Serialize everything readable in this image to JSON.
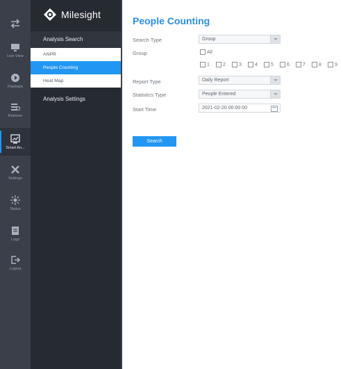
{
  "rail": {
    "items": [
      {
        "icon": "exchange-icon",
        "label": ""
      },
      {
        "icon": "live-view-icon",
        "label": "Live View"
      },
      {
        "icon": "playback-icon",
        "label": "Playback"
      },
      {
        "icon": "retrieve-icon",
        "label": "Retrieve"
      },
      {
        "icon": "smart-analysis-icon",
        "label": "Smart An..."
      },
      {
        "icon": "settings-icon",
        "label": "Settings"
      },
      {
        "icon": "status-icon",
        "label": "Status"
      },
      {
        "icon": "logs-icon",
        "label": "Logs"
      },
      {
        "icon": "logout-icon",
        "label": "Logout"
      }
    ]
  },
  "panel": {
    "brand": "Milesight",
    "sections": [
      {
        "label": "Analysis Search"
      },
      {
        "label": "Analysis Settings"
      }
    ],
    "items": [
      {
        "label": "ANPR"
      },
      {
        "label": "People Counting"
      },
      {
        "label": "Heat Map"
      }
    ]
  },
  "main": {
    "title": "People Counting",
    "search_type": {
      "label": "Search Type",
      "value": "Group"
    },
    "group": {
      "label": "Group",
      "all_label": "All",
      "options": [
        "1",
        "2",
        "3",
        "4",
        "5",
        "6",
        "7",
        "8",
        "9"
      ]
    },
    "report_type": {
      "label": "Report Type",
      "value": "Daily Report"
    },
    "statistics_type": {
      "label": "Statistics Type",
      "value": "People Entered"
    },
    "start_time": {
      "label": "Start Time",
      "value": "2021-02-20 00:00:00"
    },
    "search_button": "Search"
  },
  "colors": {
    "accent": "#2196f3",
    "title": "#2a8ee6",
    "rail": "#3a3f4a",
    "panel": "#262a31"
  }
}
